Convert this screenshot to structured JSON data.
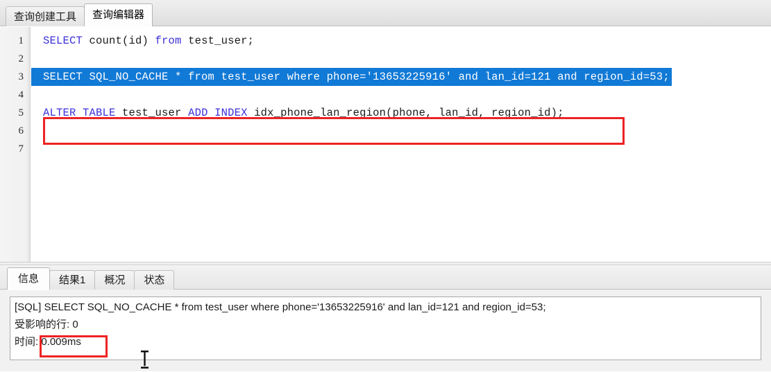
{
  "window": {
    "app": "Navicat SQL Editor"
  },
  "top_tabs": [
    {
      "label": "查询创建工具",
      "active": false
    },
    {
      "label": "查询编辑器",
      "active": true
    }
  ],
  "editor": {
    "line_numbers": [
      "1",
      "2",
      "3",
      "4",
      "5",
      "6",
      "7"
    ],
    "lines": [
      {
        "n": "1",
        "selected": false,
        "tokens": [
          {
            "t": "SELECT",
            "kw": true
          },
          {
            "t": " count(id) ",
            "kw": false
          },
          {
            "t": "from",
            "kw": true
          },
          {
            "t": " test_user;",
            "kw": false
          }
        ]
      },
      {
        "n": "2",
        "selected": false,
        "tokens": []
      },
      {
        "n": "3",
        "selected": true,
        "tokens": [
          {
            "t": "SELECT SQL_NO_CACHE",
            "kw": true
          },
          {
            "t": " * ",
            "kw": false
          },
          {
            "t": "from",
            "kw": true
          },
          {
            "t": " test_user ",
            "kw": false
          },
          {
            "t": "where",
            "kw": true
          },
          {
            "t": " phone='13653225916' ",
            "kw": false
          },
          {
            "t": "and",
            "kw": true
          },
          {
            "t": " lan_id=121 ",
            "kw": false
          },
          {
            "t": "and",
            "kw": true
          },
          {
            "t": " region_id=53;",
            "kw": false
          }
        ]
      },
      {
        "n": "4",
        "selected": false,
        "tokens": []
      },
      {
        "n": "5",
        "selected": false,
        "tokens": [
          {
            "t": "ALTER TABLE",
            "kw": true
          },
          {
            "t": " test_user ",
            "kw": false
          },
          {
            "t": "ADD INDEX",
            "kw": true
          },
          {
            "t": " idx_phone_lan_region(phone, lan_id, region_id);",
            "kw": false
          }
        ]
      },
      {
        "n": "6",
        "selected": false,
        "tokens": []
      },
      {
        "n": "7",
        "selected": false,
        "tokens": []
      }
    ],
    "plain_lines": [
      "SELECT count(id) from test_user;",
      "",
      "SELECT SQL_NO_CACHE * from test_user where phone='13653225916' and lan_id=121 and region_id=53;",
      "",
      "ALTER TABLE test_user ADD INDEX idx_phone_lan_region(phone, lan_id, region_id);",
      "",
      ""
    ]
  },
  "bottom_tabs": [
    {
      "label": "信息",
      "active": true
    },
    {
      "label": "结果1",
      "active": false
    },
    {
      "label": "概况",
      "active": false
    },
    {
      "label": "状态",
      "active": false
    }
  ],
  "info": {
    "sql_line": "[SQL] SELECT SQL_NO_CACHE * from test_user where phone='13653225916' and lan_id=121 and region_id=53;",
    "affected_rows_line": "受影响的行: 0",
    "time_label": "时间:",
    "time_value": "0.009ms",
    "time_line": "时间: 0.009ms"
  },
  "annotations": {
    "highlight_color": "#ee2222",
    "selection_color": "#1179d6",
    "keyword_color": "#3b2fd8",
    "boxes": [
      {
        "name": "alter-table-statement-box",
        "target": "editor line 5"
      },
      {
        "name": "execution-time-box",
        "target": "time value 0.009ms"
      }
    ]
  },
  "cursor": {
    "type": "text-ibeam"
  }
}
